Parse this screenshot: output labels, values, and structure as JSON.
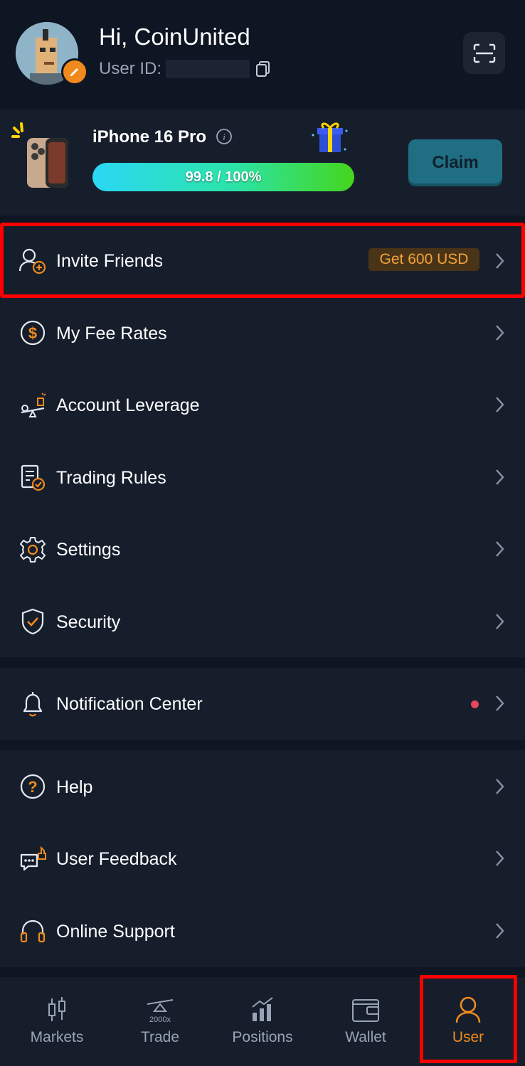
{
  "header": {
    "greeting": "Hi, CoinUnited",
    "user_id_label": "User ID:"
  },
  "promo": {
    "title": "iPhone 16 Pro",
    "progress_text": "99.8 / 100%",
    "progress_fraction": 0.998,
    "claim_label": "Claim"
  },
  "menu": {
    "invite": {
      "label": "Invite Friends",
      "badge": "Get 600 USD"
    },
    "fee_rates": {
      "label": "My Fee Rates"
    },
    "leverage": {
      "label": "Account Leverage"
    },
    "trading_rules": {
      "label": "Trading Rules"
    },
    "settings": {
      "label": "Settings"
    },
    "security": {
      "label": "Security"
    },
    "notifications": {
      "label": "Notification Center"
    },
    "help": {
      "label": "Help"
    },
    "feedback": {
      "label": "User Feedback"
    },
    "support": {
      "label": "Online Support"
    }
  },
  "nav": {
    "markets": "Markets",
    "trade": "Trade",
    "trade_icon_text": "2000x",
    "positions": "Positions",
    "wallet": "Wallet",
    "user": "User",
    "active": "User"
  },
  "colors": {
    "accent": "#f08a1c",
    "background": "#0f1623",
    "card": "#161e2c",
    "highlight": "#ff0000",
    "notification_dot": "#e8455f"
  },
  "icons": [
    "avatar-edit-icon",
    "copy-icon",
    "scan-icon",
    "info-icon",
    "gift-icon",
    "invite-user-icon",
    "dollar-icon",
    "leverage-icon",
    "rules-icon",
    "gear-icon",
    "shield-icon",
    "bell-icon",
    "help-icon",
    "feedback-icon",
    "headset-icon",
    "chevron-right-icon",
    "markets-icon",
    "trade-icon",
    "positions-icon",
    "wallet-icon",
    "user-icon"
  ]
}
